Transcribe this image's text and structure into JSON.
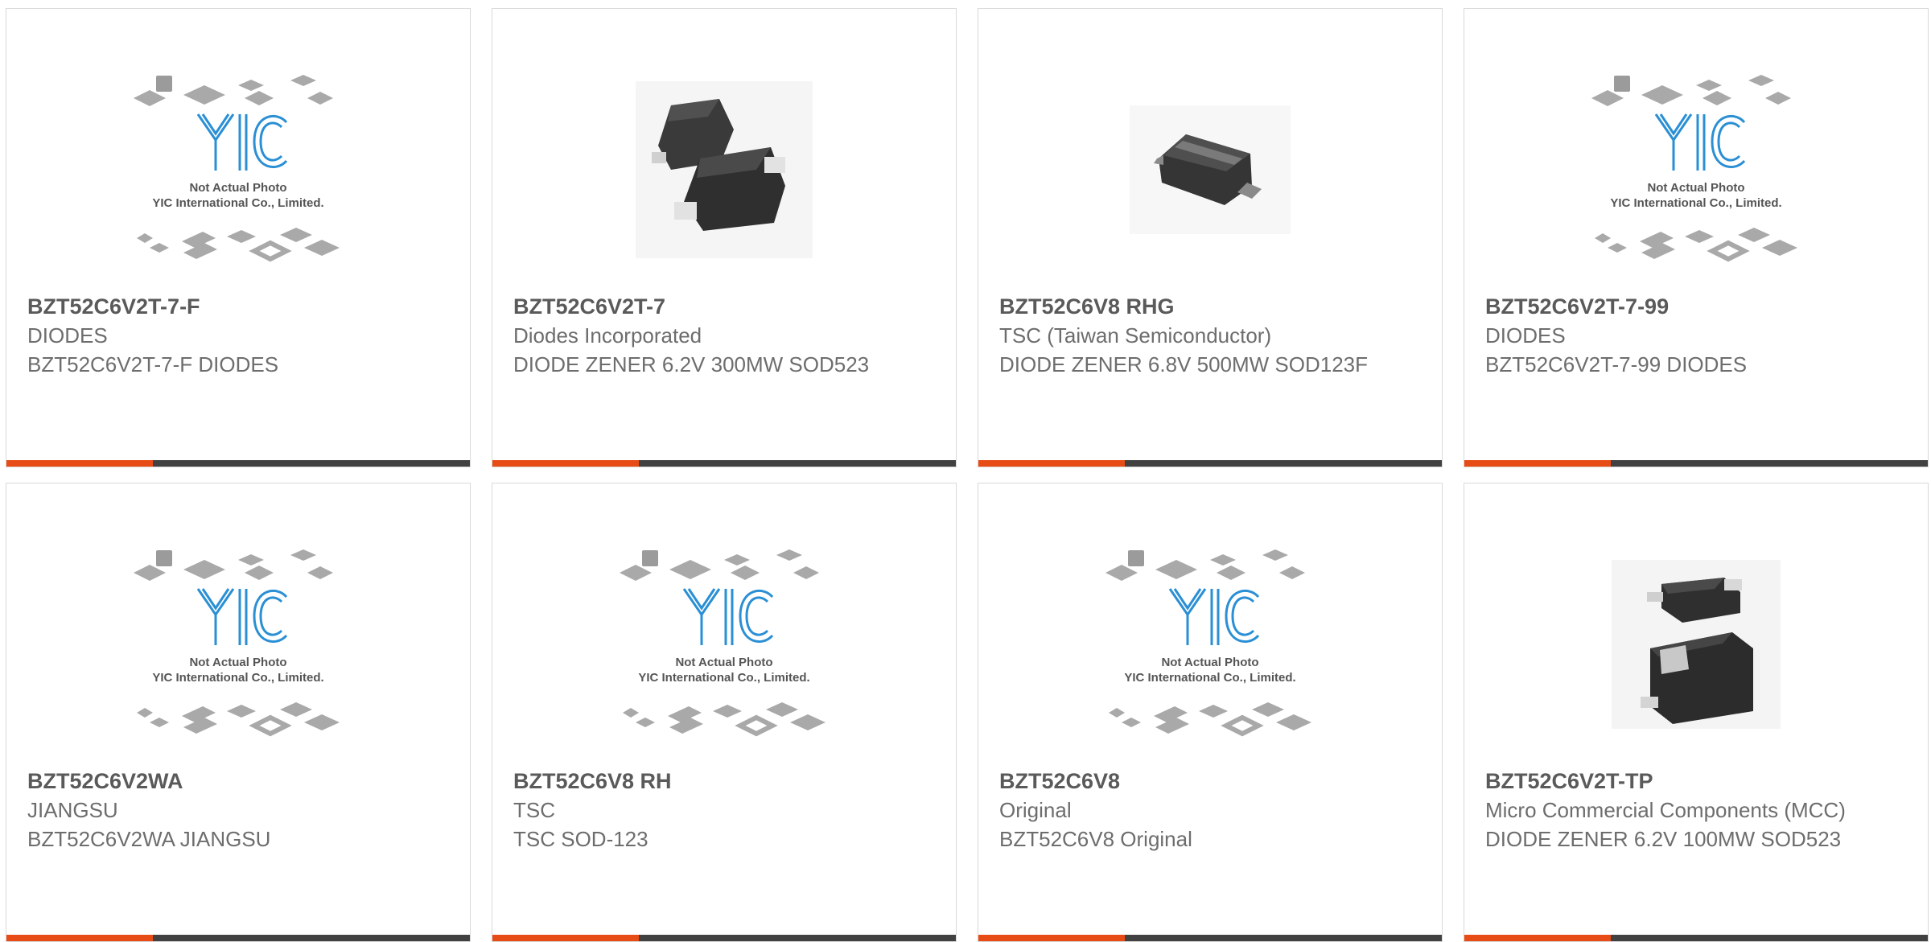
{
  "placeholder": {
    "line1": "Not Actual Photo",
    "line2": "YIC International Co., Limited.",
    "logo_text": "YIC"
  },
  "colors": {
    "accent": "#e84c16",
    "bar": "#414141",
    "logo_blue": "#2a8fd4"
  },
  "products": [
    {
      "part": "BZT52C6V2T-7-F",
      "brand": "DIODES",
      "desc": "BZT52C6V2T-7-F DIODES",
      "image": "yic-placeholder"
    },
    {
      "part": "BZT52C6V2T-7",
      "brand": "Diodes Incorporated",
      "desc": "DIODE ZENER 6.2V 300MW SOD523",
      "image": "sod523-photo"
    },
    {
      "part": "BZT52C6V8 RHG",
      "brand": "TSC (Taiwan Semiconductor)",
      "desc": "DIODE ZENER 6.8V 500MW SOD123F",
      "image": "sod123f-photo"
    },
    {
      "part": "BZT52C6V2T-7-99",
      "brand": "DIODES",
      "desc": "BZT52C6V2T-7-99 DIODES",
      "image": "yic-placeholder"
    },
    {
      "part": "BZT52C6V2WA",
      "brand": "JIANGSU",
      "desc": "BZT52C6V2WA JIANGSU",
      "image": "yic-placeholder"
    },
    {
      "part": "BZT52C6V8 RH",
      "brand": "TSC",
      "desc": "TSC SOD-123",
      "image": "yic-placeholder"
    },
    {
      "part": "BZT52C6V8",
      "brand": "Original",
      "desc": "BZT52C6V8 Original",
      "image": "yic-placeholder"
    },
    {
      "part": "BZT52C6V2T-TP",
      "brand": "Micro Commercial Components (MCC)",
      "desc": "DIODE ZENER 6.2V 100MW SOD523",
      "image": "mcc-photo"
    }
  ]
}
